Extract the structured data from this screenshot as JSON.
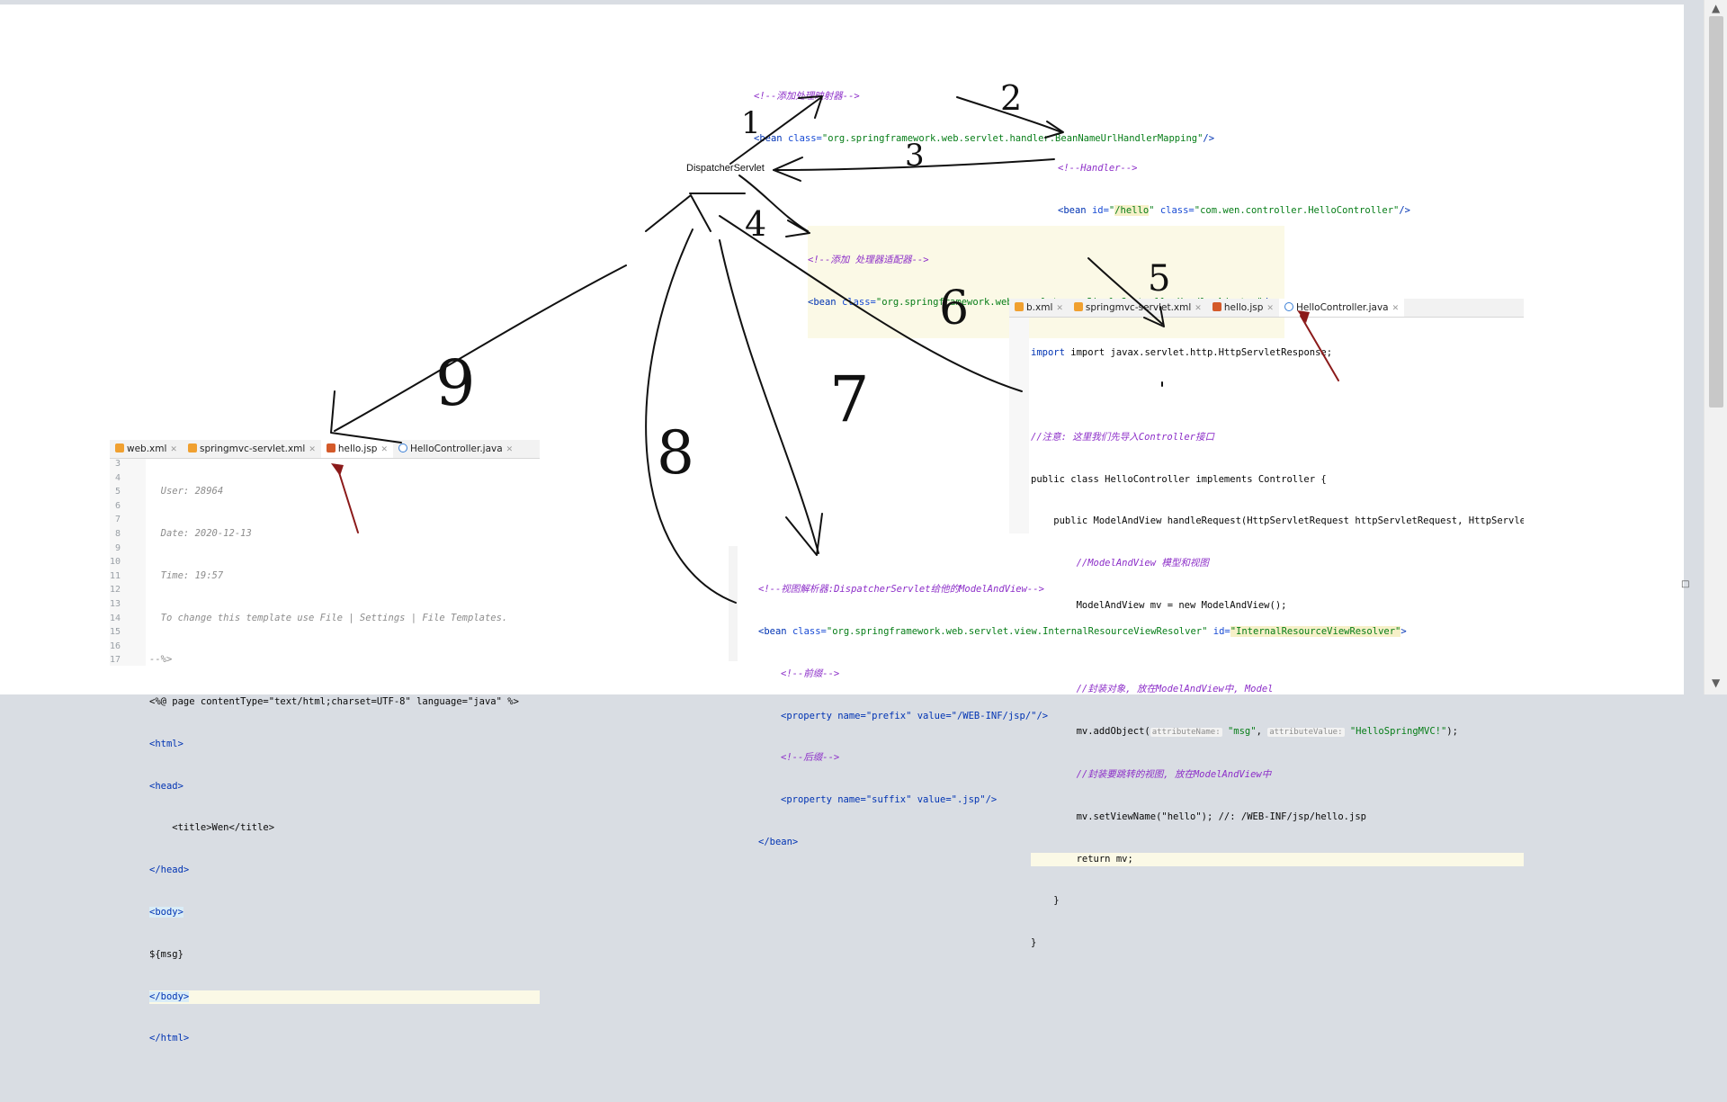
{
  "center_label": "DispatcherServlet",
  "numbers": [
    "1",
    "2",
    "3",
    "4",
    "5",
    "6",
    "7",
    "8",
    "9"
  ],
  "block_mapping": {
    "comment": "<!--添加处理映射器-->",
    "bean_open": "<bean ",
    "class_attr": "class=",
    "class_val": "\"org.springframework.web.servlet.handler.BeanNameUrlHandlerMapping\"",
    "close": "/>"
  },
  "block_handler": {
    "comment": "<!--Handler-->",
    "bean_open": "<bean ",
    "id_attr": "id=",
    "id_val_open": "\"",
    "id_val": "/hello",
    "id_val_close": "\"",
    "class_attr": " class=",
    "class_val": "\"com.wen.controller.HelloController\"",
    "close": "/>"
  },
  "block_adapter": {
    "comment": "<!--添加 处理器适配器-->",
    "bean_open": "<bean ",
    "class_attr": "class=",
    "class_val": "\"org.springframework.web.servlet.mvc.SimpleControllerHandlerAdapter\"",
    "close": "/>"
  },
  "java_tabs": [
    {
      "label": "b.xml",
      "icon": "xml"
    },
    {
      "label": "springmvc-servlet.xml",
      "icon": "xml"
    },
    {
      "label": "hello.jsp",
      "icon": "jsp"
    },
    {
      "label": "HelloController.java",
      "icon": "java",
      "active": true
    }
  ],
  "java_lines": [
    "import javax.servlet.http.HttpServletResponse;",
    "",
    "//注意: 这里我们先导入Controller接口",
    "public class HelloController implements Controller {",
    "    public ModelAndView handleRequest(HttpServletRequest httpServletRequest, HttpServletResp",
    "        //ModelAndView 模型和视图",
    "        ModelAndView mv = new ModelAndView();",
    "",
    "        //封装对象, 放在ModelAndView中, Model",
    "        mv.addObject(",
    "        //封装要跳转的视图, 放在ModelAndView中",
    "        mv.setViewName(\"hello\"); //: /WEB-INF/jsp/hello.jsp",
    "        return mv;",
    "    }",
    "}"
  ],
  "java_addobject": {
    "hint1": "attributeName:",
    "val1": "\"msg\"",
    "hint2": "attributeValue:",
    "val2": "\"HelloSpringMVC!\"",
    "end": ");"
  },
  "jsp_tabs": [
    {
      "label": "web.xml",
      "icon": "xml"
    },
    {
      "label": "springmvc-servlet.xml",
      "icon": "xml"
    },
    {
      "label": "hello.jsp",
      "icon": "jsp",
      "active": true
    },
    {
      "label": "HelloController.java",
      "icon": "java"
    }
  ],
  "jsp_line_numbers": "3\n4\n5\n6\n7\n8\n9\n10\n11\n12\n13\n14\n15\n16\n17",
  "jsp_lines": [
    "  User: 28964",
    "  Date: 2020-12-13",
    "  Time: 19:57",
    "  To change this template use File | Settings | File Templates.",
    "--%>",
    "<%@ page contentType=\"text/html;charset=UTF-8\" language=\"java\" %>",
    "<html>",
    "<head>",
    "    <title>Wen</title>",
    "</head>",
    "<body>",
    "${msg}",
    "</body>",
    "</html>",
    ""
  ],
  "block_resolver": {
    "comment": "<!--视图解析器:DispatcherServlet给他的ModelAndView-->",
    "bean_line_a": "<bean ",
    "class_attr": "class=",
    "class_val": "\"org.springframework.web.servlet.view.InternalResourceViewResolver\"",
    "id_attr": " id=",
    "id_val": "\"InternalResourceViewResolver\"",
    "bean_end": ">",
    "prefix_comment": "<!--前缀-->",
    "prefix_line": "<property name=\"prefix\" value=\"/WEB-INF/jsp/\"/>",
    "suffix_comment": "<!--后缀-->",
    "suffix_line": "<property name=\"suffix\" value=\".jsp\"/>",
    "close": "</bean>"
  },
  "scroll": {
    "up": "▲",
    "down": "▼"
  }
}
